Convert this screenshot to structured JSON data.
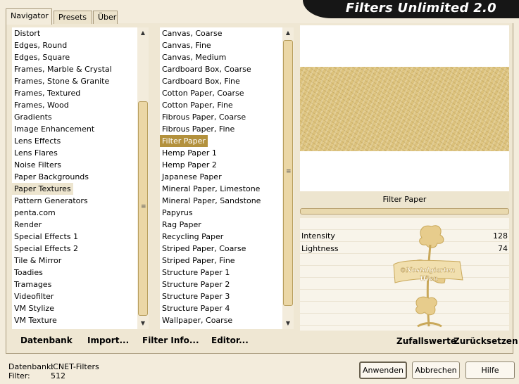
{
  "app": {
    "title": "Filters Unlimited 2.0"
  },
  "tabs": [
    {
      "label": "Navigator",
      "active": true
    },
    {
      "label": "Presets",
      "active": false
    },
    {
      "label": "Über",
      "active": false
    }
  ],
  "categories": {
    "items": [
      "Distort",
      "Edges, Round",
      "Edges, Square",
      "Frames, Marble & Crystal",
      "Frames, Stone & Granite",
      "Frames, Textured",
      "Frames, Wood",
      "Gradients",
      "Image Enhancement",
      "Lens Effects",
      "Lens Flares",
      "Noise Filters",
      "Paper Backgrounds",
      "Paper Textures",
      "Pattern Generators",
      "penta.com",
      "Render",
      "Special Effects 1",
      "Special Effects 2",
      "Tile & Mirror",
      "Toadies",
      "Tramages",
      "Videofilter",
      "VM Stylize",
      "VM Texture"
    ],
    "selected": "Paper Textures"
  },
  "filters": {
    "items": [
      "Canvas, Coarse",
      "Canvas, Fine",
      "Canvas, Medium",
      "Cardboard Box, Coarse",
      "Cardboard Box, Fine",
      "Cotton Paper, Coarse",
      "Cotton Paper, Fine",
      "Fibrous Paper, Coarse",
      "Fibrous Paper, Fine",
      "Filter Paper",
      "Hemp Paper 1",
      "Hemp Paper 2",
      "Japanese Paper",
      "Mineral Paper, Limestone",
      "Mineral Paper, Sandstone",
      "Papyrus",
      "Rag Paper",
      "Recycling Paper",
      "Striped Paper, Coarse",
      "Striped Paper, Fine",
      "Structure Paper 1",
      "Structure Paper 2",
      "Structure Paper 3",
      "Structure Paper 4",
      "Wallpaper, Coarse"
    ],
    "selected": "Filter Paper"
  },
  "panel_buttons": {
    "datenbank": "Datenbank",
    "import": "Import...",
    "filter_info": "Filter Info...",
    "editor": "Editor..."
  },
  "preview": {
    "filter_name": "Filter Paper",
    "texture_color": "#dcc27c"
  },
  "params": [
    {
      "label": "Intensity",
      "value": "128"
    },
    {
      "label": "Lightness",
      "value": "74"
    }
  ],
  "random_buttons": {
    "zufallswerte": "Zufallswerte",
    "zuruecksetzen": "Zurücksetzen"
  },
  "status": {
    "datenbank_label": "Datenbank:",
    "datenbank_value": "ICNET-Filters",
    "filter_label": "Filter:",
    "filter_value": "512"
  },
  "dialog_buttons": {
    "anwenden": "Anwenden",
    "abbrechen": "Abbrechen",
    "hilfe": "Hilfe"
  },
  "watermark": {
    "line1": "©Nostalgiarten",
    "line2": "Wien"
  },
  "colors": {
    "accent": "#b3913d",
    "banner": "#161616",
    "background": "#f3ecdc"
  }
}
